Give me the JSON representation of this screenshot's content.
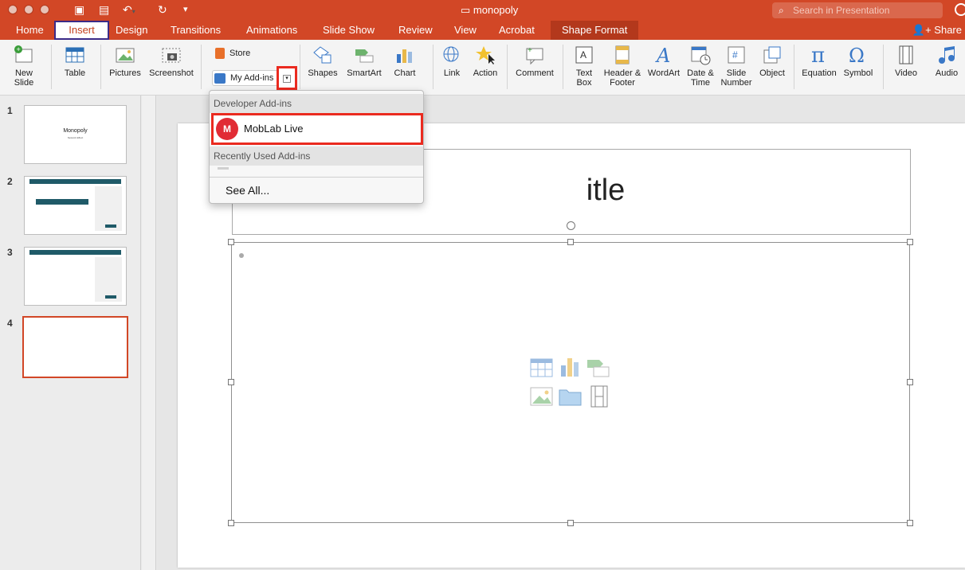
{
  "window": {
    "title": "monopoly",
    "search_placeholder": "Search in Presentation"
  },
  "tabs": [
    {
      "label": "Home"
    },
    {
      "label": "Insert"
    },
    {
      "label": "Design"
    },
    {
      "label": "Transitions"
    },
    {
      "label": "Animations"
    },
    {
      "label": "Slide Show"
    },
    {
      "label": "Review"
    },
    {
      "label": "View"
    },
    {
      "label": "Acrobat"
    },
    {
      "label": "Shape Format"
    }
  ],
  "share_label": "Share",
  "ribbon": {
    "new_slide": "New\nSlide",
    "table": "Table",
    "pictures": "Pictures",
    "screenshot": "Screenshot",
    "store": "Store",
    "my_addins": "My Add-ins",
    "shapes": "Shapes",
    "smartart": "SmartArt",
    "chart": "Chart",
    "link": "Link",
    "action": "Action",
    "comment": "Comment",
    "text_box": "Text\nBox",
    "header_footer": "Header &\nFooter",
    "wordart": "WordArt",
    "date_time": "Date &\nTime",
    "slide_number": "Slide\nNumber",
    "object": "Object",
    "equation": "Equation",
    "symbol": "Symbol",
    "video": "Video",
    "audio": "Audio"
  },
  "dropdown": {
    "developer_header": "Developer Add-ins",
    "moblab": "MobLab Live",
    "recent_header": "Recently Used Add-ins",
    "see_all": "See All..."
  },
  "thumbnails": [
    {
      "num": "1",
      "title": "Monopoly",
      "subtitle": "Network Effect"
    },
    {
      "num": "2"
    },
    {
      "num": "3"
    },
    {
      "num": "4"
    }
  ],
  "slide": {
    "title_fragment": "itle"
  },
  "colors": {
    "accent": "#d24726",
    "highlight_box": "#ea2a1f",
    "insert_outline": "#3b2a87"
  }
}
